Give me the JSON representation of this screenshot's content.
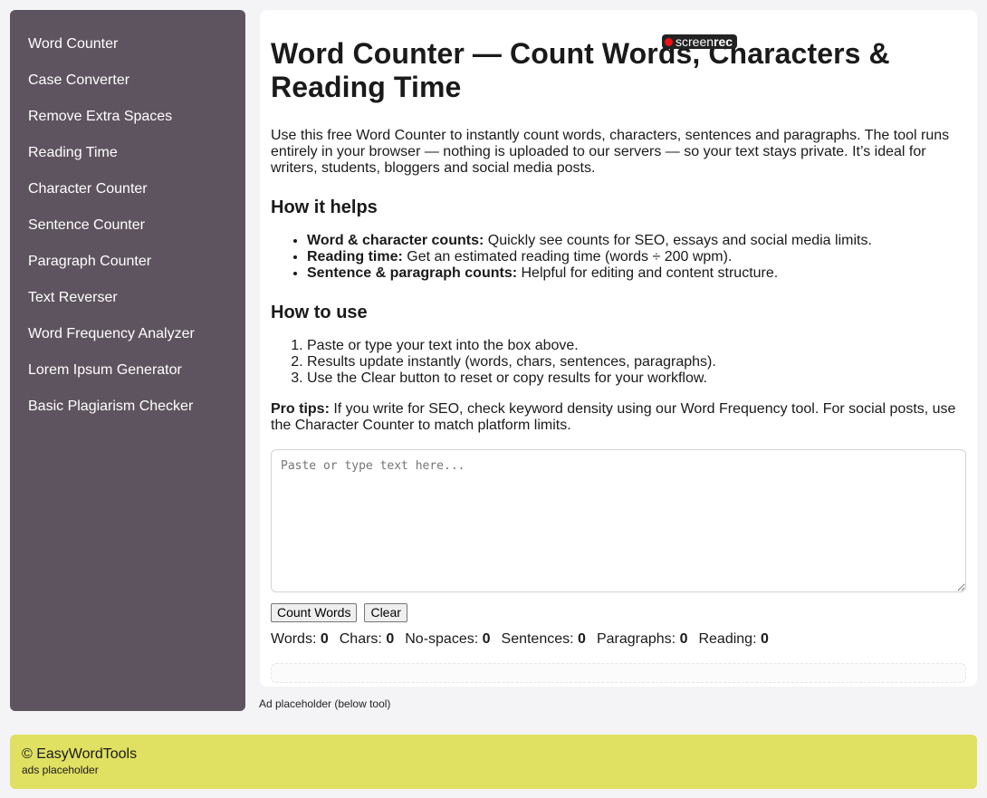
{
  "sidebar": {
    "items": [
      {
        "label": "Word Counter"
      },
      {
        "label": "Case Converter"
      },
      {
        "label": "Remove Extra Spaces"
      },
      {
        "label": "Reading Time"
      },
      {
        "label": "Character Counter"
      },
      {
        "label": "Sentence Counter"
      },
      {
        "label": "Paragraph Counter"
      },
      {
        "label": "Text Reverser"
      },
      {
        "label": "Word Frequency Analyzer"
      },
      {
        "label": "Lorem Ipsum Generator"
      },
      {
        "label": "Basic Plagiarism Checker"
      }
    ]
  },
  "recorder": {
    "label_light": "screen",
    "label_bold": "rec"
  },
  "main": {
    "title": "Word Counter — Count Words, Characters & Reading Time",
    "intro": "Use this free Word Counter to instantly count words, characters, sentences and paragraphs. The tool runs entirely in your browser — nothing is uploaded to our servers — so your text stays private. It’s ideal for writers, students, bloggers and social media posts.",
    "helps_heading": "How it helps",
    "helps": [
      {
        "term": "Word & character counts:",
        "desc": " Quickly see counts for SEO, essays and social media limits."
      },
      {
        "term": "Reading time:",
        "desc": " Get an estimated reading time (words ÷ 200 wpm)."
      },
      {
        "term": "Sentence & paragraph counts:",
        "desc": " Helpful for editing and content structure."
      }
    ],
    "use_heading": "How to use",
    "steps": [
      "Paste or type your text into the box above.",
      "Results update instantly (words, chars, sentences, paragraphs).",
      "Use the Clear button to reset or copy results for your workflow."
    ],
    "tips_label": "Pro tips:",
    "tips_text": " If you write for SEO, check keyword density using our Word Frequency tool. For social posts, use the Character Counter to match platform limits.",
    "textarea_placeholder": "Paste or type text here...",
    "textarea_value": "",
    "count_button": "Count Words",
    "clear_button": "Clear",
    "stats": [
      {
        "label": "Words:",
        "value": "0"
      },
      {
        "label": "Chars:",
        "value": "0"
      },
      {
        "label": "No-spaces:",
        "value": "0"
      },
      {
        "label": "Sentences:",
        "value": "0"
      },
      {
        "label": "Paragraphs:",
        "value": "0"
      },
      {
        "label": "Reading:",
        "value": "0"
      }
    ]
  },
  "ad_below": "Ad placeholder (below tool)",
  "footer": {
    "copyright": "© EasyWordTools",
    "ads": "ads placeholder"
  },
  "colors": {
    "sidebar_bg": "#5e545f",
    "footer_bg": "#e0e062",
    "page_bg": "#f4f4f7"
  }
}
